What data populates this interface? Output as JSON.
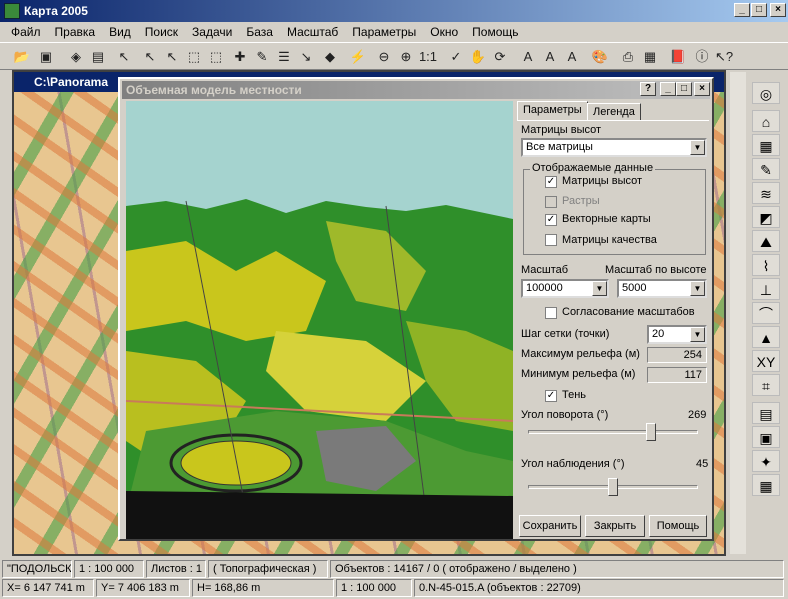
{
  "app": {
    "title": "Карта 2005"
  },
  "menu": [
    "Файл",
    "Правка",
    "Вид",
    "Поиск",
    "Задачи",
    "База",
    "Масштаб",
    "Параметры",
    "Окно",
    "Помощь"
  ],
  "map_window": {
    "title": "C:\\Panorama"
  },
  "dialog": {
    "title": "Объемная модель местности",
    "tabs": [
      "Параметры",
      "Легенда"
    ],
    "matrices_label": "Матрицы высот",
    "matrices_value": "Все матрицы",
    "group_title": "Отображаемые данные",
    "checks": [
      {
        "label": "Матрицы высот",
        "checked": true,
        "enabled": true
      },
      {
        "label": "Растры",
        "checked": false,
        "enabled": false
      },
      {
        "label": "Векторные карты",
        "checked": true,
        "enabled": true
      },
      {
        "label": "Матрицы качества",
        "checked": false,
        "enabled": true
      }
    ],
    "scale_label": "Масштаб",
    "scale_value": "100000",
    "height_scale_label": "Масштаб по высоте",
    "height_scale_value": "5000",
    "sync_label": "Согласование масштабов",
    "grid_step_label": "Шаг сетки (точки)",
    "grid_step_value": "20",
    "max_relief_label": "Максимум рельефа (м)",
    "max_relief_value": "254",
    "min_relief_label": "Минимум рельефа (м)",
    "min_relief_value": "117",
    "shadow_label": "Тень",
    "rotation_label": "Угол поворота (°)",
    "rotation_value": "269",
    "rotation_fraction": 0.74,
    "observe_label": "Угол наблюдения (°)",
    "observe_value": "45",
    "observe_fraction": 0.5,
    "buttons": {
      "save": "Сохранить",
      "close": "Закрыть",
      "help": "Помощь"
    }
  },
  "status": {
    "name": "\"ПОДОЛЬСК\"",
    "scale": "1 : 100 000",
    "sheets": "Листов : 1",
    "type": "( Топографическая )",
    "objects": "Объектов : 14167 / 0 ( отображено / выделено )",
    "x": "X=  6 147 741 m",
    "y": "Y=  7 406 183 m",
    "h": "H= 168,86 m",
    "scale2": "1 : 100 000",
    "sheet_info": "0.N-45-015.A  (объектов : 22709)"
  },
  "colors": {
    "title_active": "#0a246a",
    "title_inactive": "#808080",
    "terrain_green": "#2f8f2a",
    "terrain_yellow": "#c9c61c",
    "sky": "#a5d3cf"
  }
}
